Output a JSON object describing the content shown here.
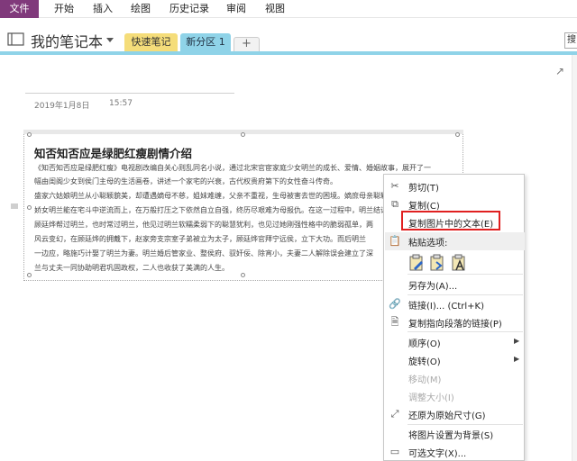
{
  "ribbon": {
    "tabs": [
      "文件",
      "开始",
      "插入",
      "绘图",
      "历史记录",
      "审阅",
      "视图"
    ]
  },
  "notebook": {
    "title": "我的笔记本",
    "sections": [
      "快速笔记",
      "新分区 1"
    ],
    "add_tab": "+",
    "search_hint": "搜"
  },
  "page": {
    "date": "2019年1月8日",
    "time": "15:57",
    "expand_icon": "↗"
  },
  "article": {
    "title": "知否知否应是绿肥红瘦剧情介绍",
    "lines": [
      "《知否知否应是绿肥红瘦》电视剧改编自关心则乱同名小说，通过北宋官宦家庭少女明兰的成长、爱情、婚姻故事，展开了一",
      "幅由闺阁少女到侯门主母的生活画卷，讲述一个家宅的兴衰，古代权贵府第下的女性奋斗传奇。",
      "盛家六姑娘明兰从小聪颖貌美，却遭遇嫡母不慈，姐妹难缠，父亲不重视，生母被害去世的困境。嫡庶母亲聪颖",
      "娇女明兰能在宅斗中逆流而上，在万般打压之下依然自立自强，终历尽艰难为母报仇。在这一过程中，明兰结识了宁远侯",
      "顾廷烨帮过明兰，也时常过明兰，他见过明兰软糯柔弱下的聪慧犹利，也见过她刚强性格中的脆弱孤单，两",
      "风云变幻，在顾廷烨的拥戴下，赵家旁支宗室子弟被立为太子，顾廷烨官拜宁远侯，立下大功。而后明兰",
      "一边应，略施巧计娶了明兰为妻。明兰婚后管家业、整侯府、驭奸佞、除宵小，夫妻二人解除误会建立了深",
      "兰与丈夫一同协助明君巩固政权，二人也收获了美满的人生。"
    ]
  },
  "context_menu": {
    "items": [
      {
        "label": "剪切(T)",
        "icon": "scissors-icon",
        "disabled": false
      },
      {
        "label": "复制(C)",
        "icon": "copy-icon",
        "disabled": false
      },
      {
        "label": "复制图片中的文本(E)",
        "icon": "",
        "disabled": false,
        "highlighted": true
      },
      {
        "label": "粘贴选项:",
        "icon": "clipboard-icon",
        "disabled": false,
        "header": true
      },
      {
        "label": "另存为(A)...",
        "icon": "",
        "disabled": false
      },
      {
        "label": "链接(I)...  (Ctrl+K)",
        "icon": "link-icon",
        "disabled": false
      },
      {
        "label": "复制指向段落的链接(P)",
        "icon": "paragraph-link-icon",
        "disabled": false
      },
      {
        "label": "顺序(O)",
        "icon": "",
        "disabled": false,
        "submenu": true
      },
      {
        "label": "旋转(O)",
        "icon": "",
        "disabled": false,
        "submenu": true
      },
      {
        "label": "移动(M)",
        "icon": "",
        "disabled": true
      },
      {
        "label": "调整大小(I)",
        "icon": "",
        "disabled": true
      },
      {
        "label": "还原为原始尺寸(G)",
        "icon": "restore-size-icon",
        "disabled": false
      },
      {
        "label": "将图片设置为背景(S)",
        "icon": "",
        "disabled": false
      },
      {
        "label": "可选文字(X)...",
        "icon": "alt-text-icon",
        "disabled": false
      }
    ]
  },
  "colors": {
    "file_tab": "#80397b",
    "quick_notes_tab": "#f5dd7a",
    "section_tab": "#8fd3e8",
    "highlight_border": "#e02020"
  }
}
